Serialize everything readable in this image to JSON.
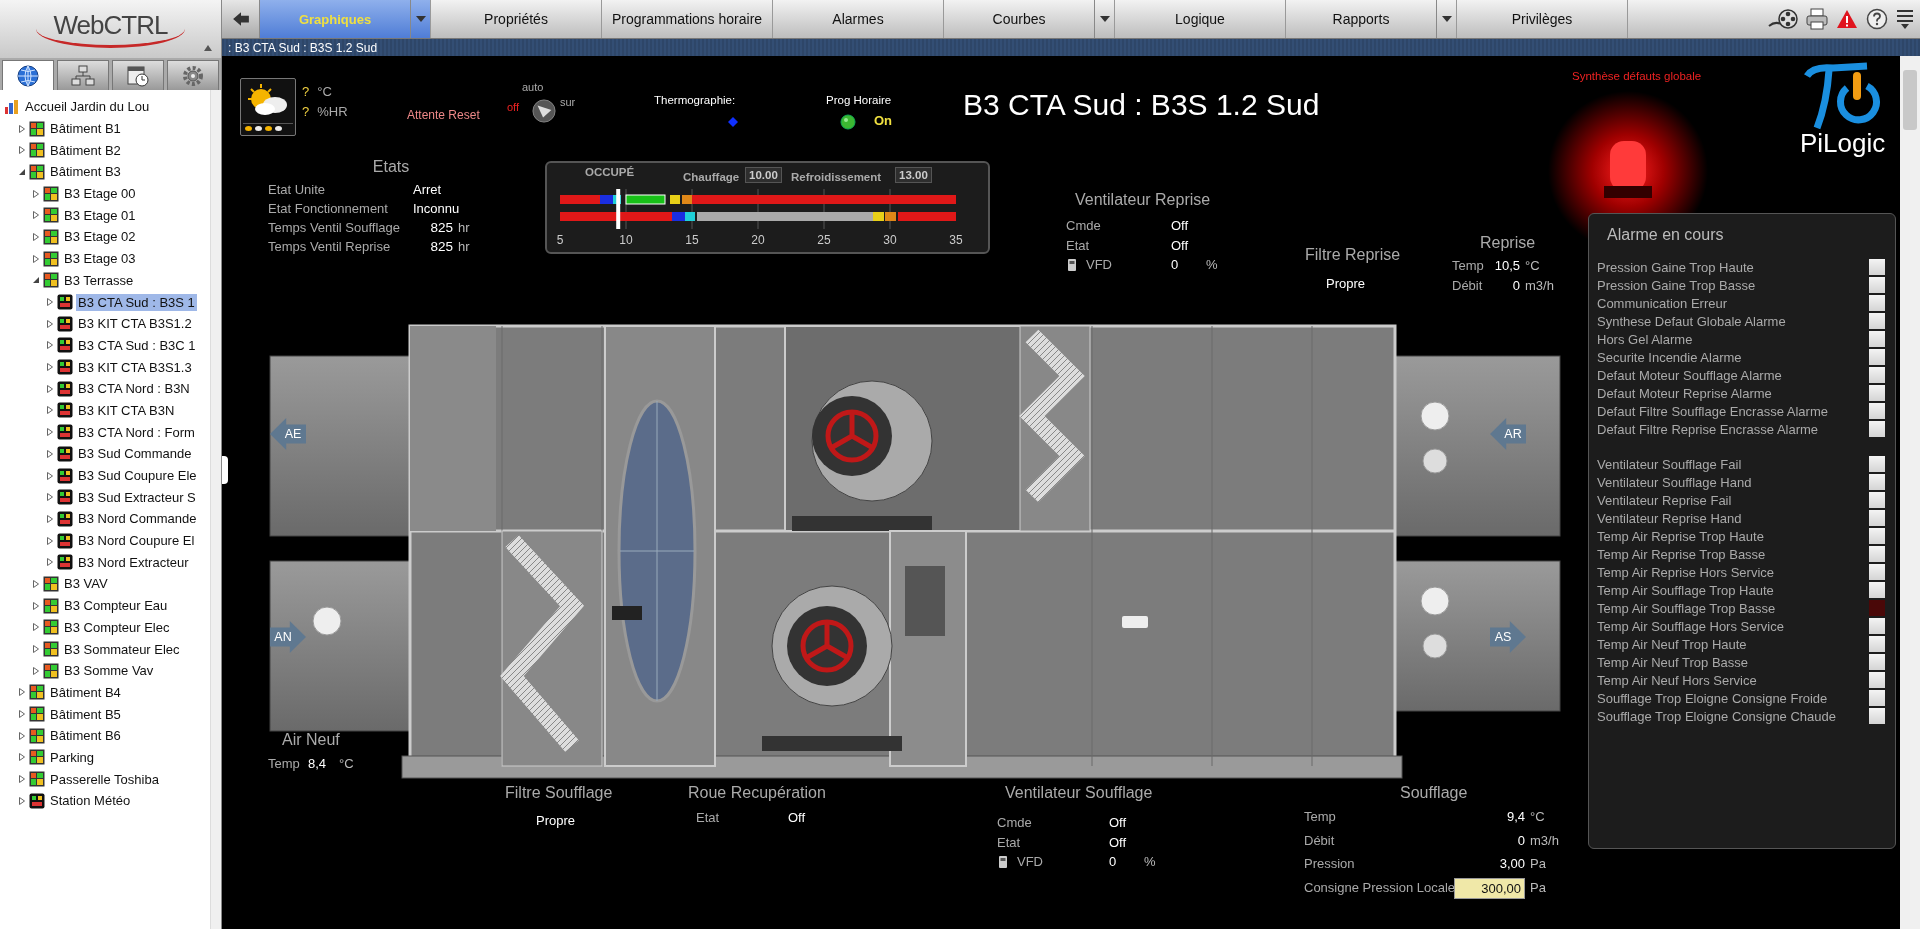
{
  "app": {
    "logo": "WebCTRL"
  },
  "sidebar": {
    "tabs": [
      {
        "selected": true
      },
      {
        "selected": false
      },
      {
        "selected": false
      },
      {
        "selected": false
      }
    ],
    "tree": [
      {
        "label": "Accueil Jardin du Lou",
        "kind": "site",
        "selected": false,
        "children": [
          {
            "label": "Bâtiment B1",
            "kind": "area",
            "expanded": false,
            "selected": false
          },
          {
            "label": "Bâtiment B2",
            "kind": "area",
            "expanded": false,
            "selected": false
          },
          {
            "label": "Bâtiment B3",
            "kind": "area",
            "expanded": true,
            "selected": false,
            "children": [
              {
                "label": "B3 Etage 00",
                "kind": "area",
                "expanded": false,
                "selected": false
              },
              {
                "label": "B3 Etage 01",
                "kind": "area",
                "expanded": false,
                "selected": false
              },
              {
                "label": "B3 Etage 02",
                "kind": "area",
                "expanded": false,
                "selected": false
              },
              {
                "label": "B3 Etage 03",
                "kind": "area",
                "expanded": false,
                "selected": false
              },
              {
                "label": "B3 Terrasse",
                "kind": "area",
                "expanded": true,
                "selected": false,
                "children": [
                  {
                    "label": "B3 CTA Sud : B3S 1",
                    "kind": "device",
                    "expanded": false,
                    "selected": true
                  },
                  {
                    "label": "B3 KIT CTA B3S1.2",
                    "kind": "device",
                    "expanded": false,
                    "selected": false
                  },
                  {
                    "label": "B3 CTA Sud : B3C 1",
                    "kind": "device",
                    "expanded": false,
                    "selected": false
                  },
                  {
                    "label": "B3 KIT CTA B3S1.3",
                    "kind": "device",
                    "expanded": false,
                    "selected": false
                  },
                  {
                    "label": "B3 CTA Nord : B3N",
                    "kind": "device",
                    "expanded": false,
                    "selected": false
                  },
                  {
                    "label": "B3 KIT CTA B3N",
                    "kind": "device",
                    "expanded": false,
                    "selected": false
                  },
                  {
                    "label": "B3 CTA Nord : Form",
                    "kind": "device",
                    "expanded": false,
                    "selected": false
                  },
                  {
                    "label": "B3 Sud Commande",
                    "kind": "device",
                    "expanded": false,
                    "selected": false
                  },
                  {
                    "label": "B3 Sud Coupure Ele",
                    "kind": "device",
                    "expanded": false,
                    "selected": false
                  },
                  {
                    "label": "B3 Sud Extracteur S",
                    "kind": "device",
                    "expanded": false,
                    "selected": false
                  },
                  {
                    "label": "B3 Nord Commande",
                    "kind": "device",
                    "expanded": false,
                    "selected": false
                  },
                  {
                    "label": "B3 Nord Coupure El",
                    "kind": "device",
                    "expanded": false,
                    "selected": false
                  },
                  {
                    "label": "B3 Nord Extracteur",
                    "kind": "device",
                    "expanded": false,
                    "selected": false
                  }
                ]
              },
              {
                "label": "B3 VAV",
                "kind": "area",
                "expanded": false,
                "selected": false
              },
              {
                "label": "B3 Compteur Eau",
                "kind": "area",
                "expanded": false,
                "selected": false
              },
              {
                "label": "B3 Compteur Elec",
                "kind": "area",
                "expanded": false,
                "selected": false
              },
              {
                "label": "B3 Sommateur Elec",
                "kind": "area",
                "expanded": false,
                "selected": false
              },
              {
                "label": "B3 Somme Vav",
                "kind": "area",
                "expanded": false,
                "selected": false
              }
            ]
          },
          {
            "label": "Bâtiment B4",
            "kind": "area",
            "expanded": false,
            "selected": false
          },
          {
            "label": "Bâtiment B5",
            "kind": "area",
            "expanded": false,
            "selected": false
          },
          {
            "label": "Bâtiment B6",
            "kind": "area",
            "expanded": false,
            "selected": false
          },
          {
            "label": "Parking",
            "kind": "area",
            "expanded": false,
            "selected": false
          },
          {
            "label": "Passerelle Toshiba",
            "kind": "area",
            "expanded": false,
            "selected": false
          },
          {
            "label": "Station Météo",
            "kind": "device",
            "expanded": false,
            "selected": false
          }
        ]
      }
    ]
  },
  "nav": {
    "tabs": [
      {
        "label": "Graphiques",
        "selected": true,
        "has_menu": true
      },
      {
        "label": "Propriétés",
        "selected": false,
        "has_menu": false
      },
      {
        "label": "Programmations horaire",
        "selected": false,
        "has_menu": false
      },
      {
        "label": "Alarmes",
        "selected": false,
        "has_menu": false
      },
      {
        "label": "Courbes",
        "selected": false,
        "has_menu": true
      },
      {
        "label": "Logique",
        "selected": false,
        "has_menu": false
      },
      {
        "label": "Rapports",
        "selected": false,
        "has_menu": true
      },
      {
        "label": "Privilèges",
        "selected": false,
        "has_menu": false
      }
    ]
  },
  "breadcrumb": ": B3 CTA Sud : B3S 1.2 Sud",
  "graphic": {
    "title": "B3 CTA Sud : B3S 1.2 Sud",
    "weather": {
      "temp": "?",
      "temp_unit": "°C",
      "humidity": "?",
      "humidity_unit": "%HR"
    },
    "reset_status": "Attente Reset",
    "mode_switch": {
      "off": "off",
      "auto": "auto",
      "on": "sur"
    },
    "thermography": {
      "label": "Thermographie:"
    },
    "schedule": {
      "label": "Prog Horaire",
      "on": true,
      "value": "On"
    },
    "global_fault": {
      "label": "Synthèse défauts globale",
      "active": true
    },
    "brand": "PiLogic",
    "states": {
      "title": "Etats",
      "rows": [
        {
          "label": "Etat Unite",
          "value": "Arret"
        },
        {
          "label": "Etat Fonctionnement",
          "value": "Inconnu"
        },
        {
          "label": "Temps Ventil Soufflage",
          "value": "825",
          "unit": "hr"
        },
        {
          "label": "Temps Ventil Reprise",
          "value": "825",
          "unit": "hr"
        }
      ]
    },
    "setpoint_band": {
      "mode": "OCCUPÉ",
      "heating_label": "Chauffage",
      "heating": "10.00",
      "cooling_label": "Refroidissement",
      "cooling": "13.00",
      "ticks": [
        "5",
        "10",
        "15",
        "20",
        "25",
        "30",
        "35"
      ],
      "level": 0.147
    },
    "return_fan": {
      "title": "Ventilateur Reprise",
      "cmd_label": "Cmde",
      "cmd": "Off",
      "state_label": "Etat",
      "state": "Off",
      "vfd_label": "VFD",
      "vfd": "0",
      "vfd_unit": "%"
    },
    "return_filter": {
      "title": "Filtre Reprise",
      "value": "Propre"
    },
    "return_air": {
      "title": "Reprise",
      "temp_label": "Temp",
      "temp": "10,5",
      "temp_unit": "°C",
      "flow_label": "Débit",
      "flow": "0",
      "flow_unit": "m3/h"
    },
    "arrows": [
      {
        "label": "AE"
      },
      {
        "label": "AR"
      },
      {
        "label": "AN"
      },
      {
        "label": "AS"
      }
    ],
    "outside_air": {
      "title": "Air Neuf",
      "temp_label": "Temp",
      "temp": "8,4",
      "temp_unit": "°C"
    },
    "supply_filter": {
      "title": "Filtre Soufflage",
      "value": "Propre"
    },
    "wheel": {
      "title": "Roue Recupération",
      "state_label": "Etat",
      "state": "Off"
    },
    "supply_fan": {
      "title": "Ventilateur Soufflage",
      "cmd_label": "Cmde",
      "cmd": "Off",
      "state_label": "Etat",
      "state": "Off",
      "vfd_label": "VFD",
      "vfd": "0",
      "vfd_unit": "%"
    },
    "supply_air": {
      "title": "Soufflage",
      "rows": [
        {
          "label": "Temp",
          "value": "9,4",
          "unit": "°C",
          "editable": false
        },
        {
          "label": "Débit",
          "value": "0",
          "unit": "m3/h",
          "editable": false
        },
        {
          "label": "Pression",
          "value": "3,00",
          "unit": "Pa",
          "editable": false
        },
        {
          "label": "Consigne Pression Locale",
          "value": "300,00",
          "unit": "Pa",
          "editable": true
        }
      ]
    },
    "alarms": {
      "title": "Alarme en cours",
      "groups": [
        [
          {
            "label": "Pression Gaine Trop Haute",
            "active": false
          },
          {
            "label": "Pression Gaine Trop Basse",
            "active": false
          },
          {
            "label": "Communication Erreur",
            "active": false
          },
          {
            "label": "Synthese Defaut Globale Alarme",
            "active": false
          },
          {
            "label": "Hors Gel Alarme",
            "active": false
          },
          {
            "label": "Securite Incendie Alarme",
            "active": false
          },
          {
            "label": "Defaut Moteur Soufflage Alarme",
            "active": false
          },
          {
            "label": "Defaut Moteur Reprise Alarme",
            "active": false
          },
          {
            "label": "Defaut Filtre Soufflage Encrasse Alarme",
            "active": false
          },
          {
            "label": "Defaut Filtre Reprise Encrasse Alarme",
            "active": false
          }
        ],
        [
          {
            "label": "Ventilateur Soufflage Fail",
            "active": false
          },
          {
            "label": "Ventilateur Soufflage Hand",
            "active": false
          },
          {
            "label": "Ventilateur Reprise Fail",
            "active": false
          },
          {
            "label": "Ventilateur Reprise Hand",
            "active": false
          },
          {
            "label": "Temp Air Reprise Trop Haute",
            "active": false
          },
          {
            "label": "Temp Air Reprise Trop Basse",
            "active": false
          },
          {
            "label": "Temp Air Reprise Hors Service",
            "active": false
          },
          {
            "label": "Temp Air Soufflage Trop Haute",
            "active": false
          },
          {
            "label": "Temp Air Soufflage Trop Basse",
            "active": true
          },
          {
            "label": "Temp Air Soufflage Hors Service",
            "active": false
          },
          {
            "label": "Temp Air Neuf Trop Haute",
            "active": false
          },
          {
            "label": "Temp Air Neuf Trop Basse",
            "active": false
          },
          {
            "label": "Temp Air Neuf Hors Service",
            "active": false
          },
          {
            "label": "Soufflage Trop Eloigne Consigne Froide",
            "active": false
          },
          {
            "label": "Soufflage Trop Eloigne Consigne Chaude",
            "active": false
          }
        ]
      ]
    }
  }
}
